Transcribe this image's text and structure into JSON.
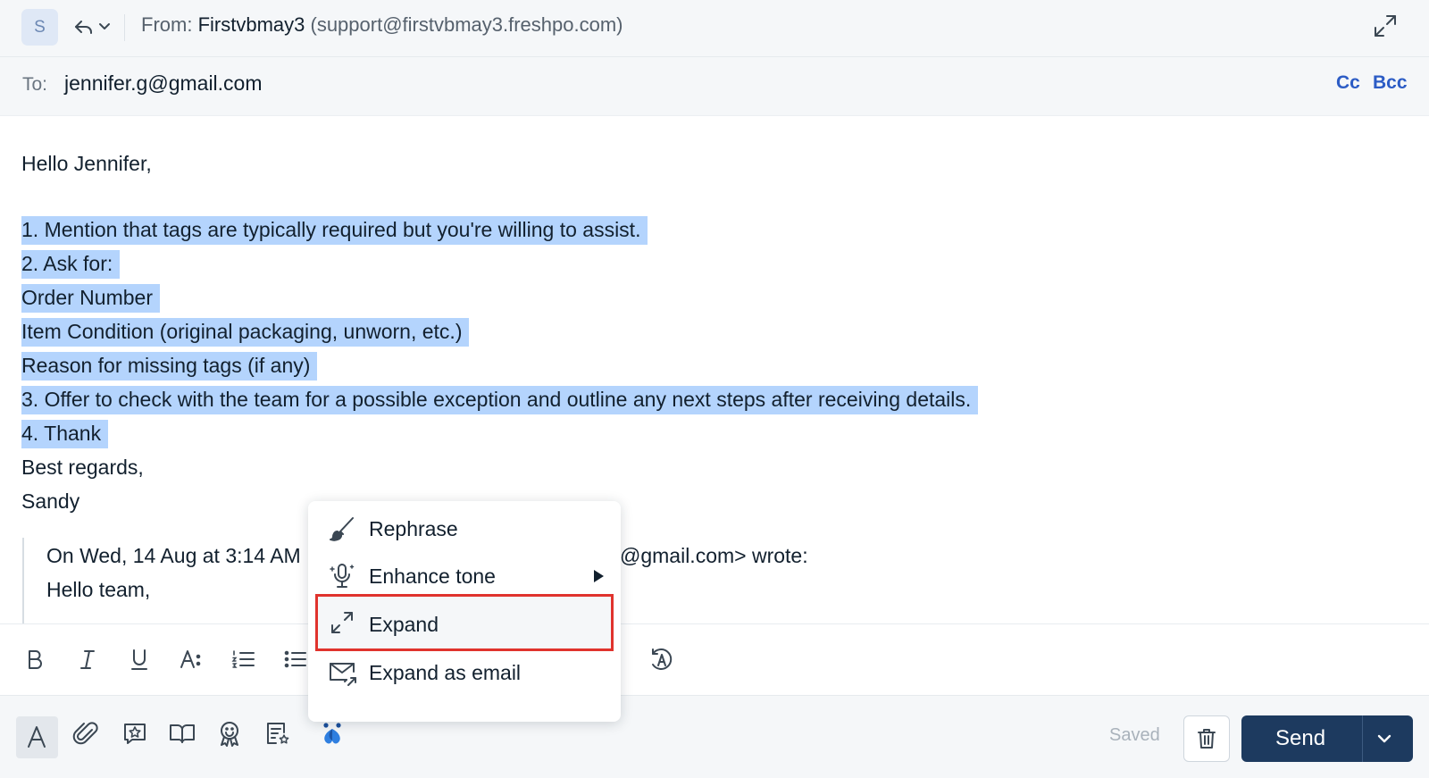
{
  "header": {
    "avatar_initial": "S",
    "from_label": "From:",
    "from_name": "Firstvbmay3",
    "from_email": "(support@firstvbmay3.freshpo.com)",
    "to_label": "To:",
    "to_email": "jennifer.g@gmail.com",
    "cc": "Cc",
    "bcc": "Bcc"
  },
  "body": {
    "greeting": "Hello Jennifer,",
    "selected_lines": [
      "1. Mention that tags are typically required but you're willing to assist.",
      "2. Ask for:",
      "Order Number",
      "Item Condition (original packaging, unworn, etc.)",
      "Reason for missing tags (if any)",
      "3. Offer to check with the team for a possible exception and outline any next steps after receiving details.",
      "4. Thank"
    ],
    "closing": "Best regards,",
    "signature": "Sandy",
    "quote_header_start": "On Wed, 14 Aug at 3:14 AM",
    "quote_header_end": "@gmail.com> wrote:",
    "quote_greeting": "Hello team,"
  },
  "ai_menu": {
    "items": [
      {
        "label": "Rephrase",
        "icon": "brush-icon"
      },
      {
        "label": "Enhance tone",
        "icon": "microphone-icon"
      },
      {
        "label": "Expand",
        "icon": "expand-arrows-icon"
      },
      {
        "label": "Expand as email",
        "icon": "email-expand-icon"
      }
    ],
    "highlighted_item": "Expand"
  },
  "footer": {
    "saved": "Saved",
    "send": "Send"
  },
  "colors": {
    "selection": "#b4d4fd",
    "link": "#2c5cc5",
    "send_button": "#1d3a5f",
    "highlight_border": "#e0332d"
  }
}
